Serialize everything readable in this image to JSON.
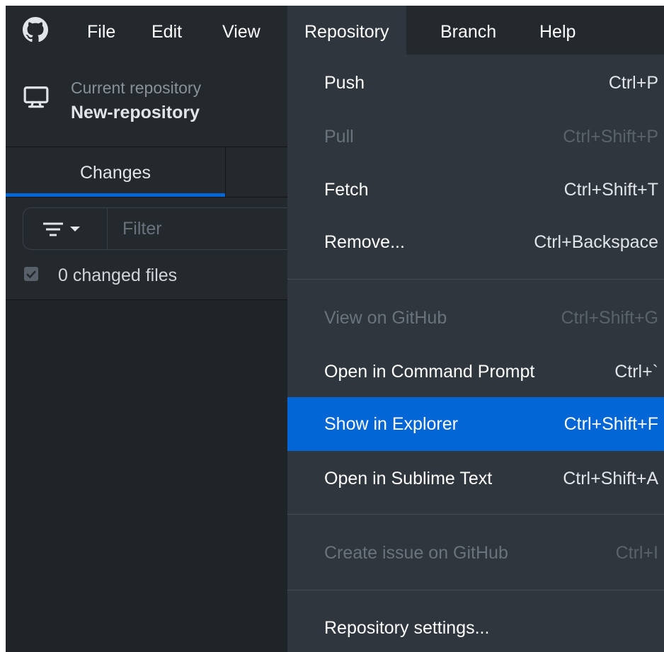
{
  "menubar": {
    "items": [
      "File",
      "Edit",
      "View",
      "Repository",
      "Branch",
      "Help"
    ],
    "active": "Repository"
  },
  "repository": {
    "label": "Current repository",
    "name": "New-repository"
  },
  "tabs": {
    "changes": "Changes"
  },
  "filter": {
    "placeholder": "Filter"
  },
  "changes": {
    "summary": "0 changed files"
  },
  "repository_menu": {
    "items": [
      {
        "label": "Push",
        "shortcut": "Ctrl+P",
        "enabled": true
      },
      {
        "label": "Pull",
        "shortcut": "Ctrl+Shift+P",
        "enabled": false
      },
      {
        "label": "Fetch",
        "shortcut": "Ctrl+Shift+T",
        "enabled": true
      },
      {
        "label": "Remove...",
        "shortcut": "Ctrl+Backspace",
        "enabled": true
      },
      {
        "label": "View on GitHub",
        "shortcut": "Ctrl+Shift+G",
        "enabled": false
      },
      {
        "label": "Open in Command Prompt",
        "shortcut": "Ctrl+`",
        "enabled": true
      },
      {
        "label": "Show in Explorer",
        "shortcut": "Ctrl+Shift+F",
        "enabled": true,
        "highlighted": true
      },
      {
        "label": "Open in Sublime Text",
        "shortcut": "Ctrl+Shift+A",
        "enabled": true
      },
      {
        "label": "Create issue on GitHub",
        "shortcut": "Ctrl+I",
        "enabled": false
      },
      {
        "label": "Repository settings...",
        "shortcut": "",
        "enabled": true
      }
    ]
  },
  "colors": {
    "background": "#24292e",
    "menu_background": "#2f363d",
    "highlight": "#0366d6",
    "disabled_text": "#6a737d"
  }
}
